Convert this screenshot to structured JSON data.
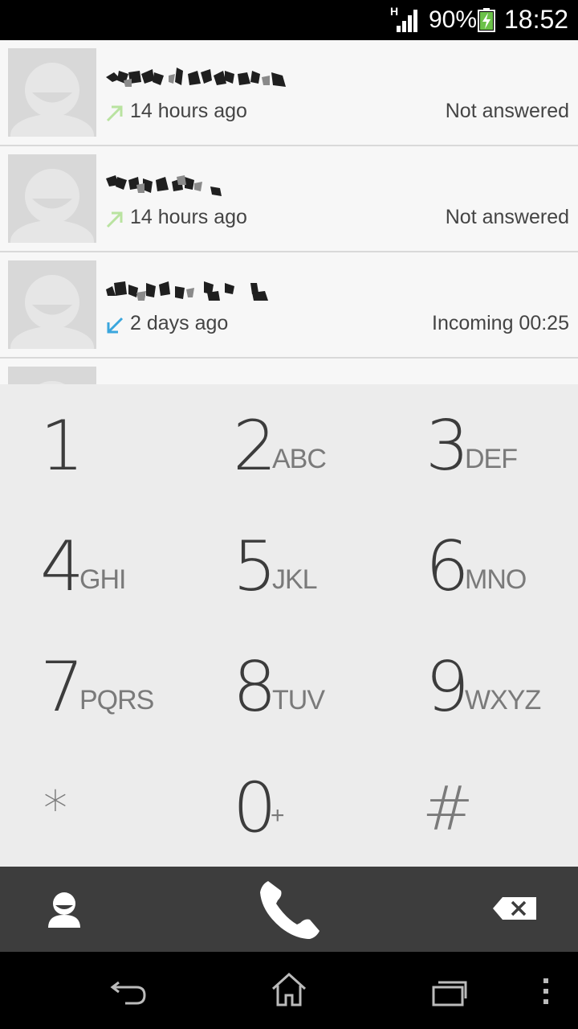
{
  "status_bar": {
    "network_type": "H",
    "battery_percent": "90%",
    "battery_level": 0.9,
    "clock": "18:52",
    "signal_icon": "signal-icon",
    "battery_icon": "battery-charging-icon"
  },
  "call_log": [
    {
      "contact_name": "",
      "time": "14 hours ago",
      "status": "Not answered",
      "direction": "outgoing",
      "direction_icon": "outgoing-arrow-icon",
      "direction_color": "#b9e3a0"
    },
    {
      "contact_name": "",
      "time": "14 hours ago",
      "status": "Not answered",
      "direction": "outgoing",
      "direction_icon": "outgoing-arrow-icon",
      "direction_color": "#b9e3a0"
    },
    {
      "contact_name": "",
      "time": "2 days ago",
      "status": "Incoming 00:25",
      "direction": "incoming",
      "direction_icon": "incoming-arrow-icon",
      "direction_color": "#3aa6dd"
    }
  ],
  "dialpad": {
    "keys": [
      {
        "digit": "1",
        "letters": ""
      },
      {
        "digit": "2",
        "letters": "ABC"
      },
      {
        "digit": "3",
        "letters": "DEF"
      },
      {
        "digit": "4",
        "letters": "GHI"
      },
      {
        "digit": "5",
        "letters": "JKL"
      },
      {
        "digit": "6",
        "letters": "MNO"
      },
      {
        "digit": "7",
        "letters": "PQRS"
      },
      {
        "digit": "8",
        "letters": "TUV"
      },
      {
        "digit": "9",
        "letters": "WXYZ"
      },
      {
        "digit": "*",
        "letters": ""
      },
      {
        "digit": "0",
        "letters": "+"
      },
      {
        "digit": "#",
        "letters": ""
      }
    ]
  },
  "action_bar": {
    "contacts_icon": "contact-person-icon",
    "call_icon": "phone-handset-icon",
    "delete_icon": "backspace-icon"
  },
  "nav_bar": {
    "back_icon": "back-icon",
    "home_icon": "home-icon",
    "recents_icon": "recent-apps-icon",
    "menu_icon": "overflow-menu-icon"
  },
  "colors": {
    "dialpad_bg": "#ececec",
    "call_log_bg": "#f7f7f7",
    "action_bar_bg": "#3d3d3d",
    "outgoing": "#b9e3a0",
    "incoming": "#3aa6dd"
  }
}
